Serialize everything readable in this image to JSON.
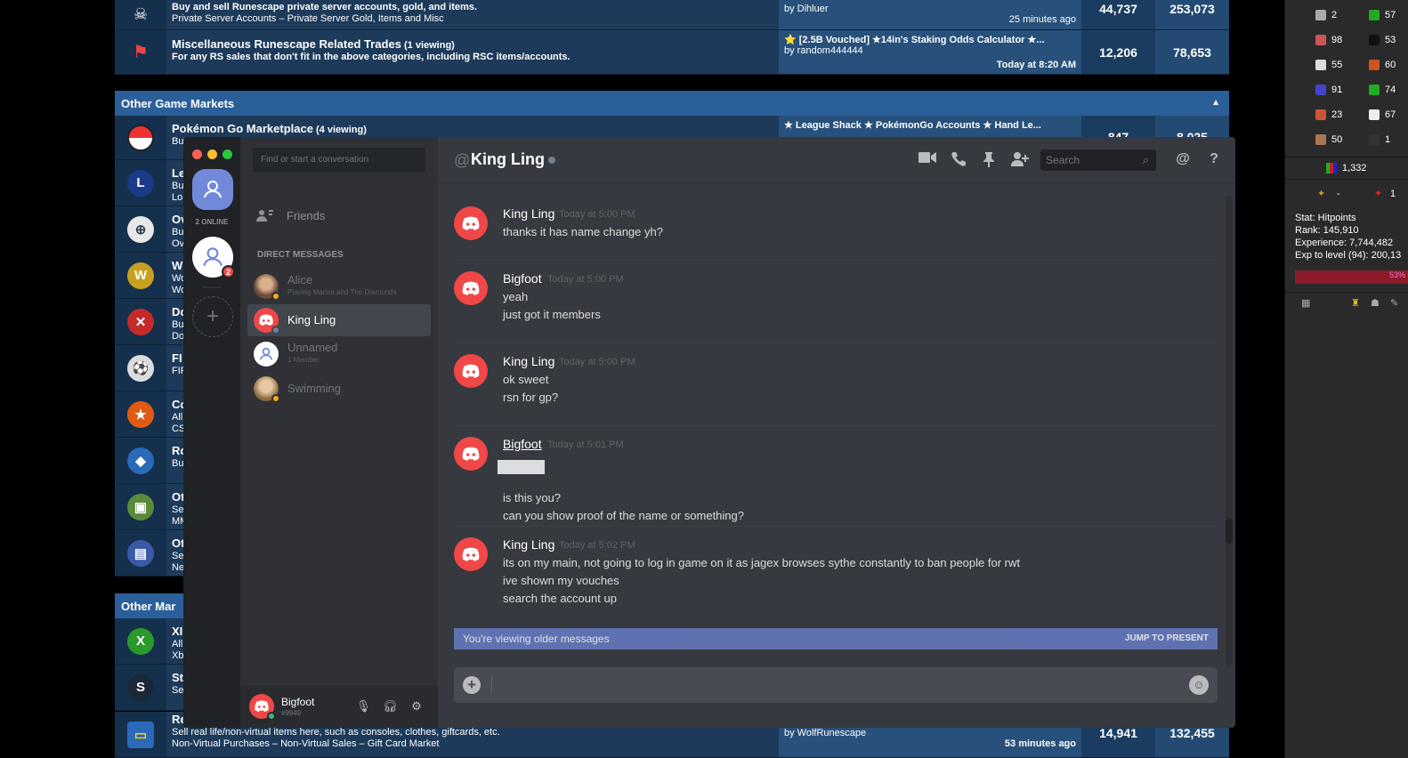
{
  "forum": {
    "rows_top": [
      {
        "title": "",
        "desc1": "Buy and sell Runescape private server accounts, gold, and items.",
        "desc2": "Private Server Accounts – Private Server Gold, Items and Misc",
        "last1": "by Dihluer",
        "last2": "25 minutes ago",
        "threads": "44,737",
        "posts": "253,073"
      },
      {
        "title": "Miscellaneous Runescape Related Trades",
        "viewing": "(1 viewing)",
        "desc1": "For any RS sales that don't fit in the above categories, including RSC items/accounts.",
        "last1": "⭐ [2.5B Vouched] ★14in's Staking Odds Calculator ★...",
        "last1b": "by random444444",
        "last2": "Today at 8:20 AM",
        "threads": "12,206",
        "posts": "78,653"
      }
    ],
    "category1": "Other Game Markets",
    "pokemon": {
      "title": "Pokémon Go Marketplace",
      "viewing": "(4 viewing)",
      "prefix": "Bu",
      "last1": "★ League Shack ★ PokémonGo Accounts ★ Hand Le...",
      "threads": "847",
      "posts": "8,025"
    },
    "side_rows": [
      {
        "l1": "Le",
        "l2": "Bu",
        "l3": "Lol",
        "icon": "L"
      },
      {
        "l1": "Ov",
        "l2": "Bu",
        "l3": "Ov",
        "icon": "⊕"
      },
      {
        "l1": "W",
        "l2": "Wo",
        "l3": "Wo",
        "icon": "W"
      },
      {
        "l1": "Do",
        "l2": "Bu",
        "l3": "Do",
        "icon": "✕"
      },
      {
        "l1": "FI",
        "l2": "FIF",
        "l3": "",
        "icon": "⚽"
      },
      {
        "l1": "Co",
        "l2": "All",
        "l3": "CS",
        "icon": "★"
      },
      {
        "l1": "Ro",
        "l2": "Bu",
        "l3": "",
        "icon": "◆"
      },
      {
        "l1": "Ot",
        "l2": "Se",
        "l3": "MM",
        "icon": "▣"
      },
      {
        "l1": "Ot",
        "l2": "Se",
        "l3": "Ne",
        "icon": "▤"
      }
    ],
    "category2": "Other Mar",
    "bottom_rows": [
      {
        "l1": "XI",
        "l2": "All",
        "l3": "Xb",
        "icon": "X"
      },
      {
        "l1": "St",
        "l2": "Se",
        "l3": "",
        "icon": "S"
      }
    ],
    "last_row": {
      "l1": "Re",
      "desc1": "Sell real life/non-virtual items here, such as consoles, clothes, giftcards, etc.",
      "desc2": "Non-Virtual Purchases – Non-Virtual Sales – Gift Card Market",
      "last1": "by WolfRunescape",
      "last2": "53 minutes ago",
      "threads": "14,941",
      "posts": "132,455"
    }
  },
  "game_panel": {
    "skills": [
      {
        "left": "2",
        "right": "57"
      },
      {
        "left": "98",
        "right": "53"
      },
      {
        "left": "55",
        "right": "60"
      },
      {
        "left": "91",
        "right": "74"
      },
      {
        "left": "23",
        "right": "67"
      },
      {
        "left": "50",
        "right": "1"
      }
    ],
    "total": "1,332",
    "row2_left": "-",
    "row2_right": "1",
    "stat_lines": [
      "Stat: Hitpoints",
      "Rank: 145,910",
      "Experience: 7,744,482",
      "Exp to level (94): 200,13"
    ],
    "bar_text": "53%"
  },
  "discord": {
    "online_label": "2 ONLINE",
    "badge_count": "2",
    "find_placeholder": "Find or start a conversation",
    "friends_label": "Friends",
    "dm_header": "DIRECT MESSAGES",
    "dms": [
      {
        "name": "Alice",
        "sub": "Playing Marina and The Diamonds",
        "active": false,
        "status": "#faa61a"
      },
      {
        "name": "King Ling",
        "sub": "",
        "active": true,
        "status": "#747f8d"
      },
      {
        "name": "Unnamed",
        "sub": "1 Member",
        "active": false,
        "status": ""
      },
      {
        "name": "Swimming",
        "sub": "",
        "active": false,
        "status": "#faa61a"
      }
    ],
    "user": {
      "name": "Bigfoot",
      "tag": "#9949"
    },
    "channel": {
      "at": "@",
      "title": "King Ling"
    },
    "search_placeholder": "Search",
    "messages": [
      {
        "author": "King Ling",
        "time": "Today at 5:00 PM",
        "lines": [
          "thanks it has name change yh?"
        ]
      },
      {
        "author": "Bigfoot",
        "time": "Today at 5:00 PM",
        "lines": [
          "yeah",
          "just got it members"
        ]
      },
      {
        "author": "King Ling",
        "time": "Today at 5:00 PM",
        "lines": [
          "ok sweet",
          "rsn for gp?"
        ]
      },
      {
        "author": "Bigfoot",
        "time": "Today at 5:01 PM",
        "lines": [
          "is this you?",
          "can you show proof of the name or something?"
        ]
      },
      {
        "author": "King Ling",
        "time": "Today at 5:02 PM",
        "lines": [
          "its on my main, not going to log in game on it as jagex browses sythe constantly to ban people for rwt",
          "ive shown my vouches",
          "search the account up"
        ]
      }
    ],
    "older_banner": "You're viewing older messages",
    "jump_label": "JUMP TO PRESENT",
    "colors": {
      "bg": "#36393f",
      "sidebar": "#2f3136",
      "guilds": "#202225",
      "blurple": "#7289da",
      "avatar_red": "#f04747"
    }
  }
}
